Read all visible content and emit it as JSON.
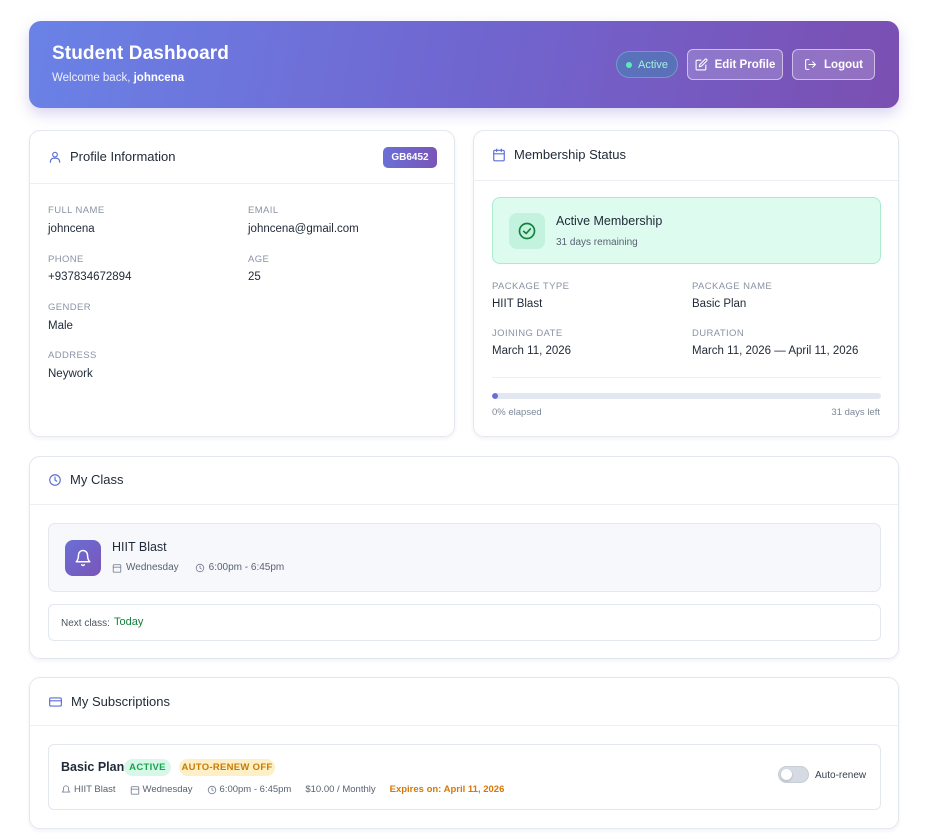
{
  "header": {
    "title": "Student Dashboard",
    "welcome_prefix": "Welcome back, ",
    "username": "johncena",
    "status_badge": "Active",
    "edit_profile_label": "Edit Profile",
    "logout_label": "Logout"
  },
  "profile": {
    "title": "Profile Information",
    "member_id": "GB6452",
    "fields": {
      "full_name": {
        "label": "FULL NAME",
        "value": "johncena"
      },
      "email": {
        "label": "EMAIL",
        "value": "johncena@gmail.com"
      },
      "phone": {
        "label": "PHONE",
        "value": "+937834672894"
      },
      "age": {
        "label": "AGE",
        "value": "25"
      },
      "gender": {
        "label": "GENDER",
        "value": "Male"
      },
      "address": {
        "label": "ADDRESS",
        "value": "Neywork"
      }
    }
  },
  "membership": {
    "title": "Membership Status",
    "status_title": "Active Membership",
    "status_subtitle": "31 days remaining",
    "fields": {
      "package_type": {
        "label": "PACKAGE TYPE",
        "value": "HIIT Blast"
      },
      "package_name": {
        "label": "PACKAGE NAME",
        "value": "Basic Plan"
      },
      "joining_date": {
        "label": "JOINING DATE",
        "value": "March 11, 2026"
      },
      "duration": {
        "label": "DURATION",
        "value": "March 11, 2026 — April 11, 2026"
      }
    },
    "progress_percent": 0,
    "progress_elapsed_label": "0% elapsed",
    "progress_remaining_label": "31 days left"
  },
  "my_class": {
    "title": "My Class",
    "class_name": "HIIT Blast",
    "day": "Wednesday",
    "time": "6:00pm - 6:45pm",
    "next_class_label": "Next class:",
    "next_class_value": "Today"
  },
  "subscriptions": {
    "title": "My Subscriptions",
    "plan_name": "Basic Plan",
    "status_pill": "ACTIVE",
    "renew_pill": "AUTO-RENEW OFF",
    "class_name": "HIIT Blast",
    "day": "Wednesday",
    "time": "6:00pm - 6:45pm",
    "price": "$10.00 / Monthly",
    "expires": "Expires on: April 11, 2026",
    "auto_renew_label": "Auto-renew",
    "auto_renew_on": false
  },
  "colors": {
    "accent": "#6a6fd6",
    "success": "#16a34a",
    "warning": "#d97706"
  },
  "icons": {
    "profile": "user-icon",
    "membership": "calendar-icon",
    "status": "check-circle-icon",
    "class": "clock-icon",
    "class_item": "bell-icon",
    "subscriptions": "credit-card-icon",
    "edit": "edit-icon",
    "logout": "logout-icon"
  }
}
